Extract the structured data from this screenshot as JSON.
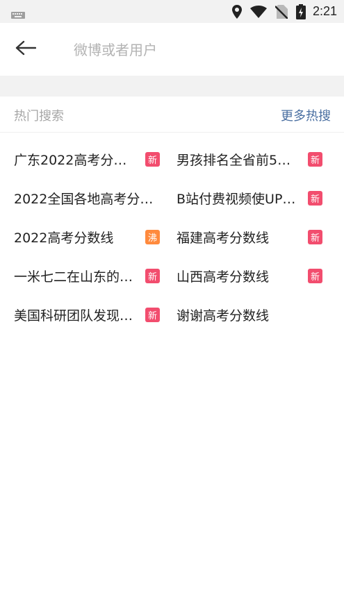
{
  "status_bar": {
    "time": "2:21",
    "icons": [
      "keyboard-icon",
      "location-icon",
      "wifi-icon",
      "no-sim-icon",
      "battery-charging-icon"
    ]
  },
  "search": {
    "placeholder": "微博或者用户",
    "value": "",
    "back_icon": "back-arrow-icon"
  },
  "hot_search": {
    "title": "热门搜索",
    "more_label": "更多热搜",
    "colors": {
      "new": "#f24d6e",
      "boil": "#ff8a3d",
      "more_link": "#4a6fa1"
    },
    "items": [
      {
        "text": "广东2022高考分…",
        "badge": "新",
        "badge_type": "new"
      },
      {
        "text": "男孩排名全省前5…",
        "badge": "新",
        "badge_type": "new"
      },
      {
        "text": "2022全国各地高考分…",
        "badge": "",
        "badge_type": ""
      },
      {
        "text": "B站付费视频使UP…",
        "badge": "新",
        "badge_type": "new"
      },
      {
        "text": "2022高考分数线",
        "badge": "沸",
        "badge_type": "boil"
      },
      {
        "text": "福建高考分数线",
        "badge": "新",
        "badge_type": "new"
      },
      {
        "text": "一米七二在山东的…",
        "badge": "新",
        "badge_type": "new"
      },
      {
        "text": "山西高考分数线",
        "badge": "新",
        "badge_type": "new"
      },
      {
        "text": "美国科研团队发现…",
        "badge": "新",
        "badge_type": "new"
      },
      {
        "text": "谢谢高考分数线",
        "badge": "",
        "badge_type": ""
      }
    ]
  }
}
